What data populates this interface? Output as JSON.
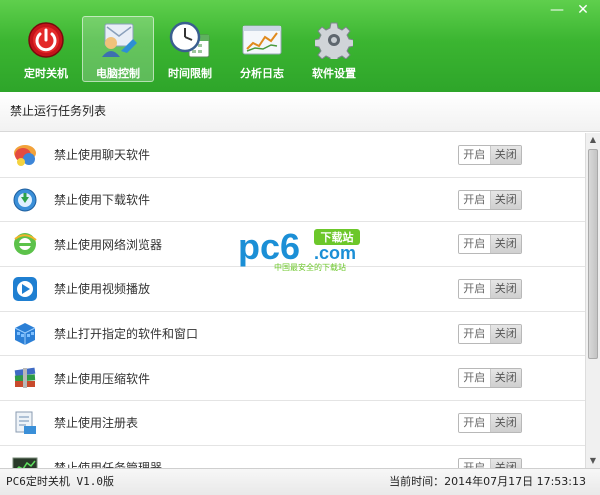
{
  "window": {
    "minimize": "—",
    "close": "✕"
  },
  "nav": [
    {
      "label": "定时关机",
      "icon": "power-icon"
    },
    {
      "label": "电脑控制",
      "icon": "computer-control-icon"
    },
    {
      "label": "时间限制",
      "icon": "clock-calendar-icon"
    },
    {
      "label": "分析日志",
      "icon": "analysis-log-icon"
    },
    {
      "label": "软件设置",
      "icon": "gear-icon"
    }
  ],
  "active_nav": "电脑控制",
  "section_title": "禁止运行任务列表",
  "rows": [
    {
      "label": "禁止使用聊天软件",
      "icon": "chat-icon",
      "on": "开启",
      "off": "关闭"
    },
    {
      "label": "禁止使用下载软件",
      "icon": "download-icon",
      "on": "开启",
      "off": "关闭"
    },
    {
      "label": "禁止使用网络浏览器",
      "icon": "browser-icon",
      "on": "开启",
      "off": "关闭"
    },
    {
      "label": "禁止使用视频播放",
      "icon": "video-player-icon",
      "on": "开启",
      "off": "关闭"
    },
    {
      "label": "禁止打开指定的软件和窗口",
      "icon": "window-cube-icon",
      "on": "开启",
      "off": "关闭"
    },
    {
      "label": "禁止使用压缩软件",
      "icon": "archive-icon",
      "on": "开启",
      "off": "关闭"
    },
    {
      "label": "禁止使用注册表",
      "icon": "registry-icon",
      "on": "开启",
      "off": "关闭"
    },
    {
      "label": "禁止使用任务管理器",
      "icon": "task-manager-icon",
      "on": "开启",
      "off": "关闭"
    }
  ],
  "watermark": {
    "brand": "pc6",
    "badge": "下载站",
    "domain": ".com",
    "tagline": "中国最安全的下载站"
  },
  "status": {
    "app_version": "PC6定时关机 V1.0版",
    "time_label": "当前时间：",
    "time_value": "2014年07月17日  17:53:13"
  },
  "colors": {
    "header_green": "#3bb531",
    "watermark_blue": "#1b8fd6",
    "watermark_green": "#6cc72a"
  }
}
